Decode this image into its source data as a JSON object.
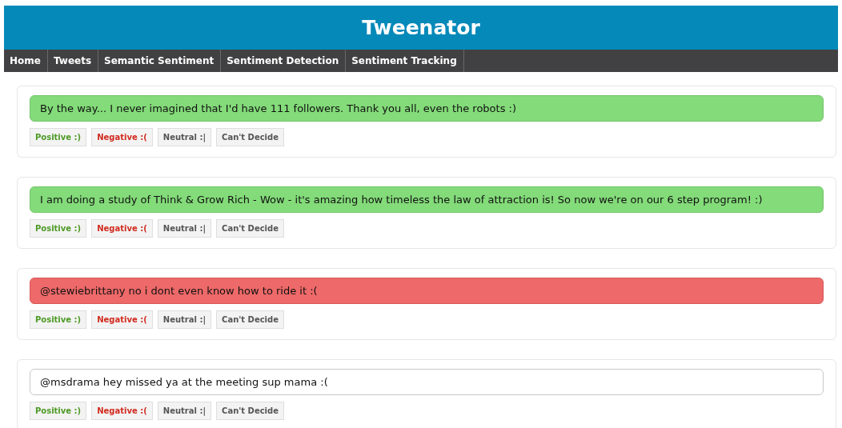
{
  "header": {
    "title": "Tweenator"
  },
  "nav": [
    {
      "label": "Home"
    },
    {
      "label": "Tweets"
    },
    {
      "label": "Semantic Sentiment"
    },
    {
      "label": "Sentiment Detection"
    },
    {
      "label": "Sentiment Tracking"
    }
  ],
  "tweets": [
    {
      "text": "By the way... I never imagined that I'd have 111 followers. Thank you all, even the robots :)",
      "kind": "positive",
      "buttons": [
        {
          "label": "Positive :)",
          "kind": "positive"
        },
        {
          "label": "Negative :(",
          "kind": "negative"
        },
        {
          "label": "Neutral :|",
          "kind": "neutral"
        },
        {
          "label": "Can't Decide",
          "kind": "undecided"
        }
      ]
    },
    {
      "text": "I am doing a study of Think & Grow Rich - Wow - it's amazing how timeless the law of attraction is! So now we're on our 6 step program! :)",
      "kind": "positive",
      "buttons": [
        {
          "label": "Positive :)",
          "kind": "positive"
        },
        {
          "label": "Negative :(",
          "kind": "negative"
        },
        {
          "label": "Neutral :|",
          "kind": "neutral"
        },
        {
          "label": "Can't Decide",
          "kind": "undecided"
        }
      ]
    },
    {
      "text": "@stewiebrittany no i dont even know how to ride it :(",
      "kind": "negative",
      "buttons": [
        {
          "label": "Positive :)",
          "kind": "positive"
        },
        {
          "label": "Negative :(",
          "kind": "negative"
        },
        {
          "label": "Neutral :|",
          "kind": "neutral"
        },
        {
          "label": "Can't Decide",
          "kind": "undecided"
        }
      ]
    },
    {
      "text": "@msdrama hey missed ya at the meeting sup mama :(",
      "kind": "neutral",
      "buttons": [
        {
          "label": "Positive :)",
          "kind": "positive"
        },
        {
          "label": "Negative :(",
          "kind": "negative"
        },
        {
          "label": "Neutral :|",
          "kind": "neutral"
        },
        {
          "label": "Can't Decide",
          "kind": "undecided"
        }
      ]
    }
  ]
}
